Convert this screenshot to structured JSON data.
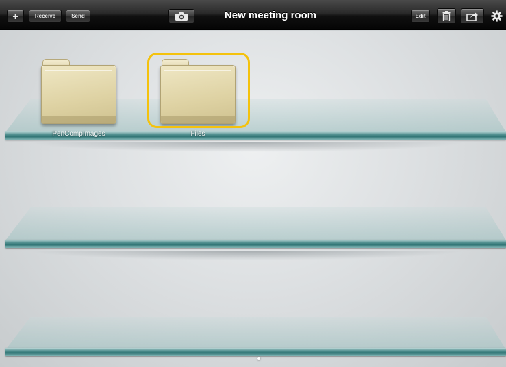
{
  "toolbar": {
    "add_label": "+",
    "receive_label": "Receive",
    "send_label": "Send",
    "title": "New meeting room",
    "edit_label": "Edit"
  },
  "icons": {
    "add": "plus-icon",
    "camera": "camera-icon",
    "trash": "trash-icon",
    "share": "share-icon",
    "settings": "gear-icon"
  },
  "folders": [
    {
      "name": "PenCompImages",
      "selected": false
    },
    {
      "name": "Files",
      "selected": true
    }
  ],
  "colors": {
    "selection": "#f4c20d",
    "toolbar": "#1a1a1a"
  },
  "pager": {
    "pages": 1,
    "current": 1
  }
}
